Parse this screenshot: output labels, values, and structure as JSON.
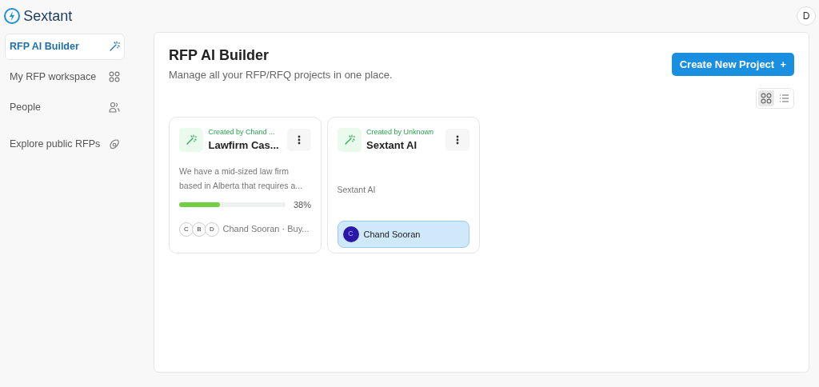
{
  "brand": {
    "name": "Sextant"
  },
  "user": {
    "initial": "D"
  },
  "sidebar": {
    "items": [
      {
        "label": "RFP AI Builder",
        "selected": true
      },
      {
        "label": "My RFP workspace",
        "selected": false
      },
      {
        "label": "People",
        "selected": false
      },
      {
        "label": "Explore public RFPs",
        "selected": false
      }
    ]
  },
  "page": {
    "title": "RFP AI Builder",
    "subtitle": "Manage all your RFP/RFQ projects in one place.",
    "create_button": "Create New Project",
    "create_icon": "+"
  },
  "view_toggle": [
    {
      "kind": "grid",
      "selected": true
    },
    {
      "kind": "list",
      "selected": false
    }
  ],
  "projects": [
    {
      "kind": "progress",
      "creator": "Created by Chand ...",
      "title": "Lawfirm Cas...",
      "description": "We have a mid-sized law firm based in Alberta that requires a...",
      "level": 0.38,
      "percent": "38%",
      "avatars": [
        "C",
        "B",
        "D"
      ],
      "members": "Chand Sooran · Buy..."
    },
    {
      "kind": "owner",
      "creator": "Created by Unknown",
      "title": "Sextant AI",
      "description": "Sextant AI",
      "owner_initial": "C",
      "owner": "Chand Sooran"
    }
  ]
}
